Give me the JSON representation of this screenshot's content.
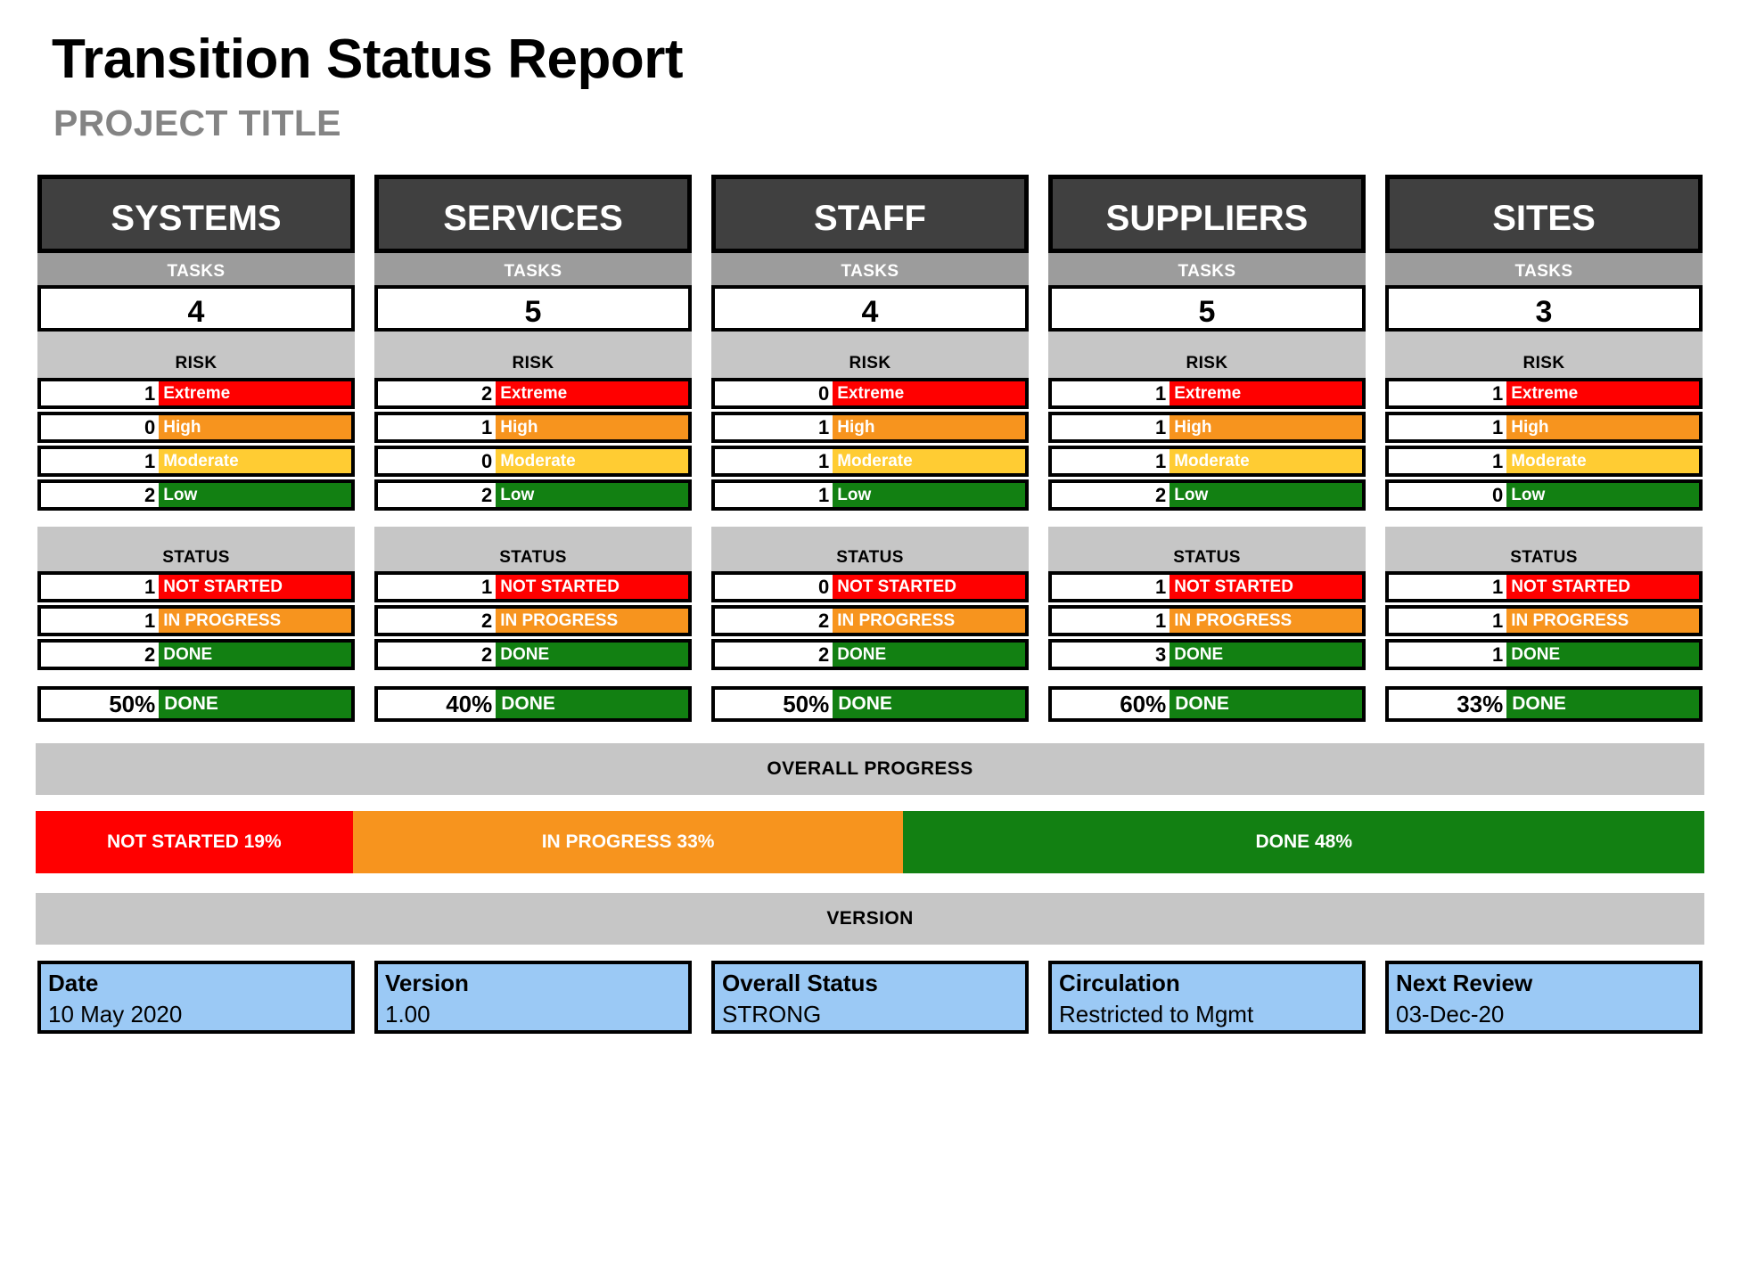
{
  "header": {
    "title": "Transition Status Report",
    "subtitle": "PROJECT TITLE"
  },
  "section_labels": {
    "tasks": "TASKS",
    "risk": "RISK",
    "status": "STATUS",
    "done": "DONE",
    "overall_progress": "OVERALL PROGRESS",
    "version": "VERSION"
  },
  "colors": {
    "extreme": "#FF0000",
    "high": "#F7941E",
    "moderate": "#FFCC33",
    "low": "#128012",
    "not_started": "#FF0000",
    "in_progress": "#F7941E",
    "done": "#128012",
    "header_fill": "#404040",
    "band_mid": "#9C9C9C",
    "band_light": "#C6C6C6",
    "footer_fill": "#9BC9F5"
  },
  "risk_labels": [
    "Extreme",
    "High",
    "Moderate",
    "Low"
  ],
  "status_labels": [
    "NOT STARTED",
    "IN PROGRESS",
    "DONE"
  ],
  "columns": [
    {
      "name": "SYSTEMS",
      "tasks": "4",
      "risk": [
        "1",
        "0",
        "1",
        "2"
      ],
      "status": [
        "1",
        "1",
        "2"
      ],
      "percent_done": "50%"
    },
    {
      "name": "SERVICES",
      "tasks": "5",
      "risk": [
        "2",
        "1",
        "0",
        "2"
      ],
      "status": [
        "1",
        "2",
        "2"
      ],
      "percent_done": "40%"
    },
    {
      "name": "STAFF",
      "tasks": "4",
      "risk": [
        "0",
        "1",
        "1",
        "1"
      ],
      "status": [
        "0",
        "2",
        "2"
      ],
      "percent_done": "50%"
    },
    {
      "name": "SUPPLIERS",
      "tasks": "5",
      "risk": [
        "1",
        "1",
        "1",
        "2"
      ],
      "status": [
        "1",
        "1",
        "3"
      ],
      "percent_done": "60%"
    },
    {
      "name": "SITES",
      "tasks": "3",
      "risk": [
        "1",
        "1",
        "1",
        "0"
      ],
      "status": [
        "1",
        "1",
        "1"
      ],
      "percent_done": "33%"
    }
  ],
  "overall_progress": {
    "segments": [
      {
        "label": "NOT STARTED 19%",
        "percent": 19
      },
      {
        "label": "IN PROGRESS 33%",
        "percent": 33
      },
      {
        "label": "DONE 48%",
        "percent": 48
      }
    ]
  },
  "footer": [
    {
      "label": "Date",
      "value": "10 May 2020"
    },
    {
      "label": "Version",
      "value": "1.00"
    },
    {
      "label": "Overall Status",
      "value": "STRONG"
    },
    {
      "label": "Circulation",
      "value": "Restricted to Mgmt"
    },
    {
      "label": "Next Review",
      "value": "03-Dec-20"
    }
  ],
  "chart_data": {
    "type": "bar",
    "title": "Transition Status Report",
    "subtitle": "PROJECT TITLE",
    "categories": [
      "SYSTEMS",
      "SERVICES",
      "STAFF",
      "SUPPLIERS",
      "SITES"
    ],
    "tasks": [
      4,
      5,
      4,
      5,
      3
    ],
    "series": [
      {
        "name": "Risk: Extreme",
        "values": [
          1,
          2,
          0,
          1,
          1
        ]
      },
      {
        "name": "Risk: High",
        "values": [
          0,
          1,
          1,
          1,
          1
        ]
      },
      {
        "name": "Risk: Moderate",
        "values": [
          1,
          0,
          1,
          1,
          1
        ]
      },
      {
        "name": "Risk: Low",
        "values": [
          2,
          2,
          1,
          2,
          0
        ]
      },
      {
        "name": "Status: NOT STARTED",
        "values": [
          1,
          1,
          0,
          1,
          1
        ]
      },
      {
        "name": "Status: IN PROGRESS",
        "values": [
          1,
          2,
          2,
          1,
          1
        ]
      },
      {
        "name": "Status: DONE",
        "values": [
          2,
          2,
          2,
          3,
          1
        ]
      }
    ],
    "percent_done": [
      50,
      40,
      50,
      60,
      33
    ],
    "overall": {
      "not_started": 19,
      "in_progress": 33,
      "done": 48
    },
    "xlabel": "",
    "ylabel": "",
    "legend": "inline"
  }
}
